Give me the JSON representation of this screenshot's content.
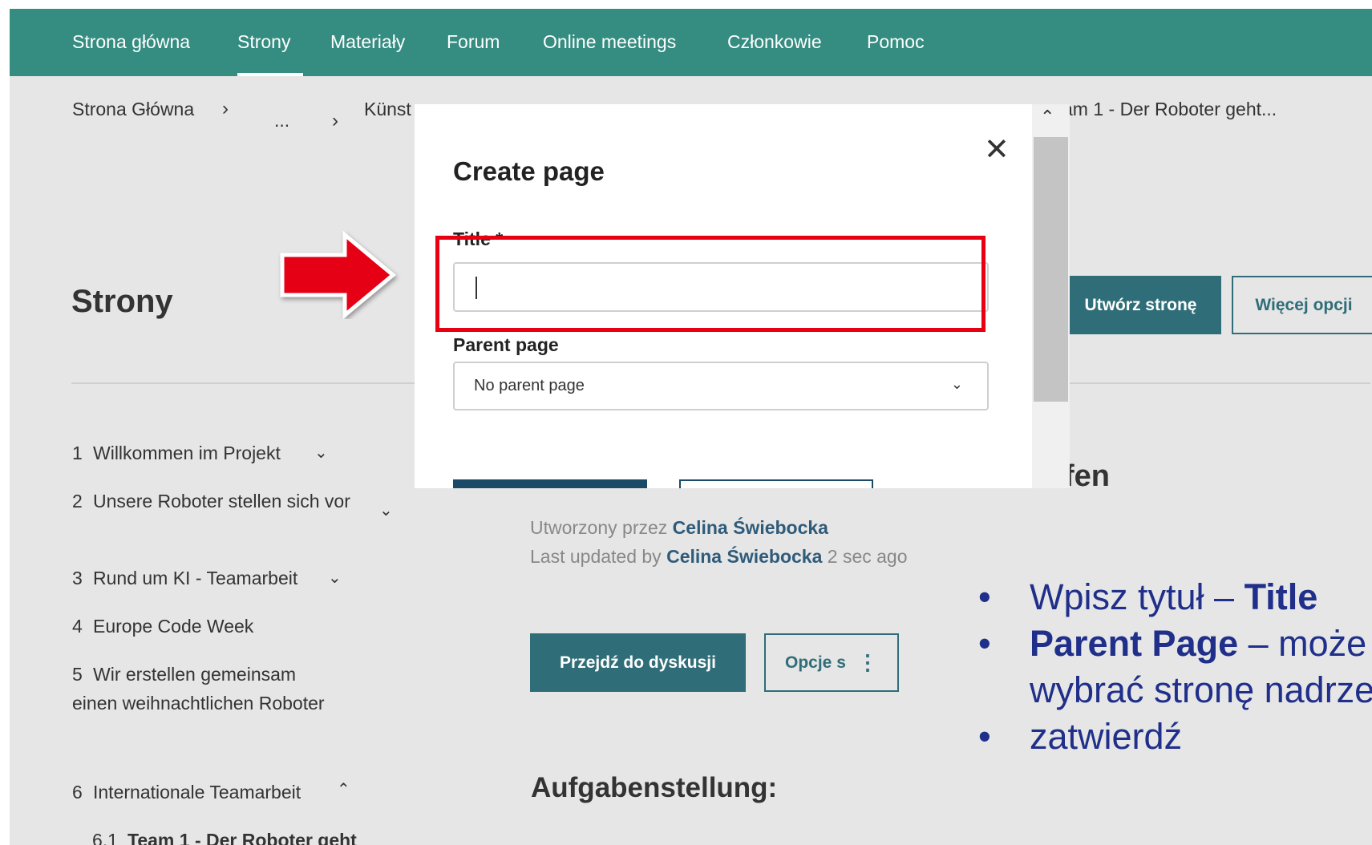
{
  "nav": {
    "items": [
      "Strona główna",
      "Strony",
      "Materiały",
      "Forum",
      "Online meetings",
      "Członkowie",
      "Pomoc"
    ],
    "active": "Strony"
  },
  "breadcrumb": {
    "home": "Strona Główna",
    "ellipsis": "...",
    "mid": "Künst",
    "end": "am 1 - Der Roboter geht..."
  },
  "page": {
    "heading": "Strony",
    "create_button": "Utwórz stronę",
    "more_options_button": "Więcej opcji",
    "section_heading_partial": "fen",
    "created_by_label": "Utworzony przez",
    "created_by_name": "Celina Świebocka",
    "updated_by_label": "Last updated by",
    "updated_by_name": "Celina Świebocka",
    "updated_ago": "2 sec ago",
    "discuss_button": "Przejdź do dyskusji",
    "page_options_button": "Opcje s",
    "task_heading": "Aufgabenstellung:"
  },
  "tree": [
    {
      "num": "1",
      "label": "Willkommen im Projekt",
      "expanded": false
    },
    {
      "num": "2",
      "label": "Unsere Roboter stellen sich vor",
      "expanded": false
    },
    {
      "num": "3",
      "label": "Rund um KI - Teamarbeit",
      "expanded": false
    },
    {
      "num": "4",
      "label": "Europe Code Week"
    },
    {
      "num": "5",
      "label": "Wir erstellen gemeinsam einen weihnachtlichen Roboter"
    },
    {
      "num": "6",
      "label": "Internationale Teamarbeit",
      "expanded": true
    },
    {
      "num": "6.1",
      "label": "Team 1 - Der Roboter geht"
    }
  ],
  "modal": {
    "title": "Create page",
    "title_label": "Title *",
    "title_value": "",
    "parent_label": "Parent page",
    "parent_value": "No parent page"
  },
  "annotation": {
    "line1_text": "Wpisz tytuł – ",
    "line1_bold": "Title",
    "line2_bold": "Parent Page",
    "line2_text": " – może",
    "line3_text": "wybrać stronę nadrze",
    "line4_text": "zatwierdź",
    "highlight_color": "#e60012",
    "bullet_color": "#1f2f8a"
  },
  "colors": {
    "nav_bg": "#358c81",
    "primary_button": "#2f6e78",
    "page_bg": "#e6e6e6"
  }
}
